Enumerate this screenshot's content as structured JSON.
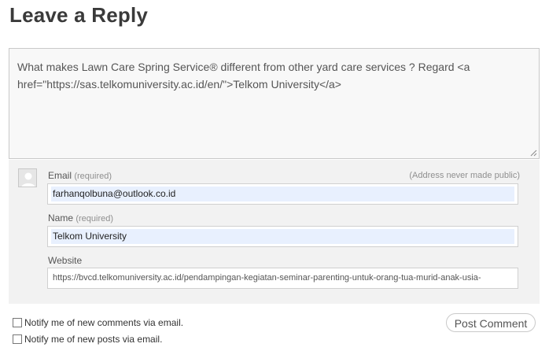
{
  "heading": "Leave a Reply",
  "comment": {
    "text": "What makes Lawn Care Spring Service® different from other yard care services ? Regard <a href=\"https://sas.telkomuniversity.ac.id/en/\">Telkom University</a>"
  },
  "email": {
    "label": "Email",
    "required": "(required)",
    "note": "(Address never made public)",
    "value": "farhanqolbuna@outlook.co.id"
  },
  "name": {
    "label": "Name",
    "required": "(required)",
    "value": "Telkom University"
  },
  "website": {
    "label": "Website",
    "value": "https://bvcd.telkomuniversity.ac.id/pendampingan-kegiatan-seminar-parenting-untuk-orang-tua-murid-anak-usia-"
  },
  "notify": {
    "comments_label": "Notify me of new comments via email.",
    "posts_label": "Notify me of new posts via email."
  },
  "submit_label": "Post Comment",
  "icons": {
    "avatar": "default-avatar-icon",
    "resize": "resize-handle-icon"
  },
  "colors": {
    "autofill": "#e8f0fe",
    "panel": "#f2f2f2"
  }
}
